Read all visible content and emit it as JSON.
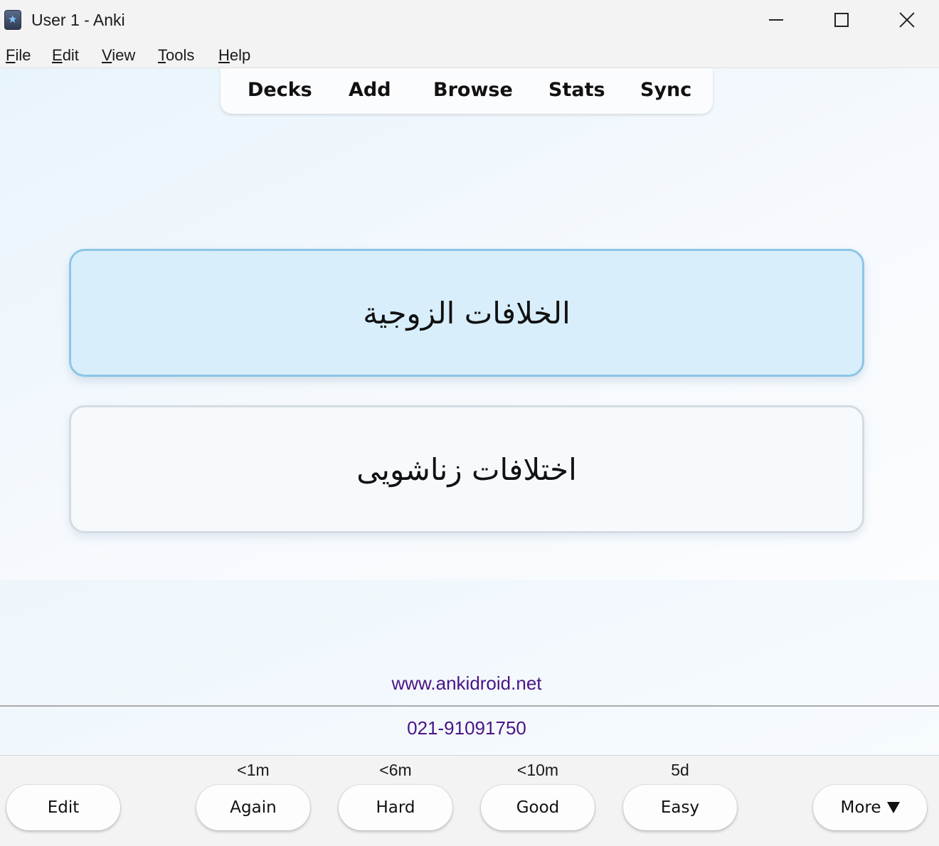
{
  "window": {
    "title": "User 1 - Anki"
  },
  "menubar": {
    "items": [
      {
        "mnemonic": "F",
        "rest": "ile"
      },
      {
        "mnemonic": "E",
        "rest": "dit"
      },
      {
        "mnemonic": "V",
        "rest": "iew"
      },
      {
        "mnemonic": "T",
        "rest": "ools"
      },
      {
        "mnemonic": "H",
        "rest": "elp"
      }
    ]
  },
  "toolbar": {
    "items": [
      "Decks",
      "Add",
      "Browse",
      "Stats",
      "Sync"
    ]
  },
  "card": {
    "front": "الخلافات الزوجية",
    "back": "اختلافات زناشویی"
  },
  "footer": {
    "url": "www.ankidroid.net",
    "phone": "021-91091750"
  },
  "answer_bar": {
    "edit_label": "Edit",
    "buttons": [
      {
        "label": "Again",
        "interval": "<1m"
      },
      {
        "label": "Hard",
        "interval": "<6m"
      },
      {
        "label": "Good",
        "interval": "<10m"
      },
      {
        "label": "Easy",
        "interval": "5d"
      }
    ],
    "more_label": "More"
  },
  "colors": {
    "front_card_bg": "#d8eefb",
    "front_card_border": "#8cc6e6",
    "footer_text": "#4b1485"
  }
}
